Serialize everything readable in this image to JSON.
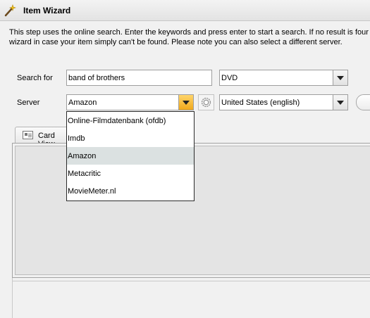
{
  "window": {
    "title": "Item Wizard",
    "icon": "wizard-wand-icon"
  },
  "description": [
    "This step uses the online search. Enter the keywords and press enter to start a search. If no result is four",
    "wizard in case your item simply can't be found. Please note you can also select a different server."
  ],
  "search": {
    "label": "Search for",
    "value": "band of brothers",
    "type_value": "DVD"
  },
  "server": {
    "label": "Server",
    "value": "Amazon",
    "region_value": "United States (english)",
    "options": [
      "Online-Filmdatenbank (ofdb)",
      "Imdb",
      "Amazon",
      "Metacritic",
      "MovieMeter.nl"
    ],
    "selected_option": "Amazon"
  },
  "tabs": [
    {
      "label": "Card View",
      "icon": "card-view-icon"
    }
  ],
  "colors": {
    "active_button": "#f0a81a",
    "selected_row": "#dbe1e1"
  }
}
